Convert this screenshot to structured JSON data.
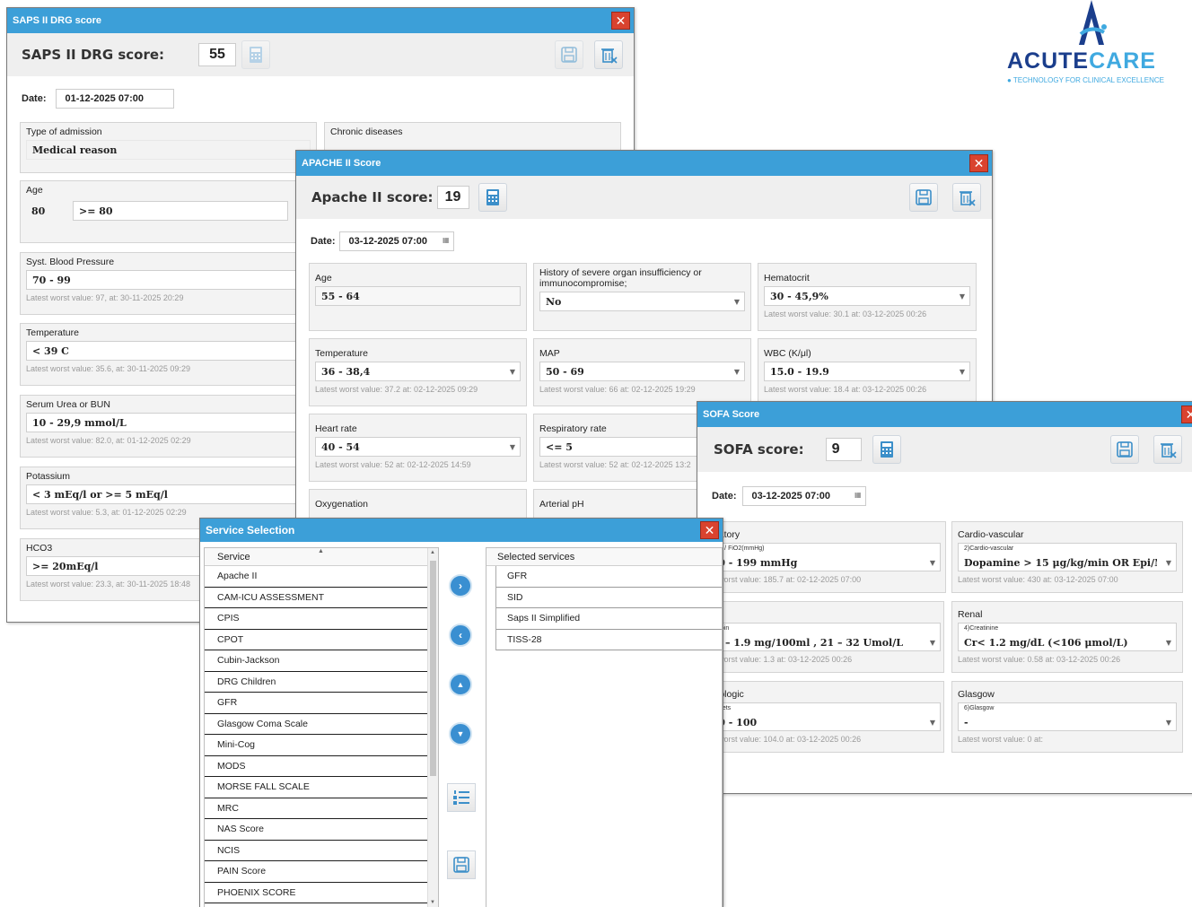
{
  "brand": {
    "name_a": "ACUTE",
    "name_b": "CARE",
    "tagline": "TECHNOLOGY FOR CLINICAL EXCELLENCE",
    "color_dark": "#1b3e8c",
    "color_light": "#3fa9e0"
  },
  "saps": {
    "title": "SAPS II DRG score",
    "score_label": "SAPS II DRG score:",
    "score": "55",
    "date_label": "Date:",
    "date": "01-12-2025 07:00",
    "type_label": "Type of admission",
    "type_value": "Medical reason",
    "chronic_label": "Chronic diseases",
    "age_label": "Age",
    "age_value": "80",
    "age_range": ">= 80",
    "bp_label": "Syst. Blood Pressure",
    "bp_value": "70 - 99",
    "bp_hint": "Latest worst value: 97, at: 30-11-2025 20:29",
    "temp_label": "Temperature",
    "temp_value": "< 39  C",
    "temp_hint": "Latest worst value: 35.6, at: 30-11-2025 09:29",
    "urea_label": "Serum Urea or BUN",
    "urea_value": "10 - 29,9 mmol/L",
    "urea_hint": "Latest worst value: 82.0, at: 01-12-2025 02:29",
    "k_label": "Potassium",
    "k_value": "< 3 mEq/l or >= 5 mEq/l",
    "k_hint": "Latest worst value: 5.3, at: 01-12-2025 02:29",
    "hco3_label": "HCO3",
    "hco3_value": ">= 20mEq/l",
    "hco3_hint": "Latest worst value: 23.3, at: 30-11-2025 18:48"
  },
  "apache": {
    "title": "APACHE II Score",
    "score_label": "Apache II score:",
    "score": "19",
    "date_label": "Date:",
    "date": "03-12-2025 07:00",
    "age_label": "Age",
    "age_value": "55 - 64",
    "hist_label": "History of severe organ insufficiency or immunocompromise;",
    "hist_value": "No",
    "hct_label": "Hematocrit",
    "hct_value": "30 - 45,9%",
    "hct_hint": "Latest worst value: 30.1 at: 03-12-2025 00:26",
    "temp_label": "Temperature",
    "temp_value": "36 - 38,4",
    "temp_hint": "Latest worst value: 37.2 at: 02-12-2025 09:29",
    "map_label": "MAP",
    "map_value": "50 - 69",
    "map_hint": "Latest worst value: 66 at: 02-12-2025 19:29",
    "wbc_label": "WBC (K/μl)",
    "wbc_value": "15.0 - 19.9",
    "wbc_hint": "Latest worst value: 18.4 at: 03-12-2025 00:26",
    "hr_label": "Heart rate",
    "hr_value": "40 - 54",
    "hr_hint": "Latest worst value: 52 at: 02-12-2025 14:59",
    "rr_label": "Respiratory rate",
    "rr_value": "<= 5",
    "rr_hint": "Latest worst value: 52 at: 02-12-2025 13:2",
    "oxy_label": "Oxygenation",
    "ph_label": "Arterial pH"
  },
  "sofa": {
    "title": "SOFA Score",
    "score_label": "SOFA score:",
    "score": "9",
    "date_label": "Date:",
    "date": "03-12-2025 07:00",
    "resp_label": "espiratory",
    "resp_sub": ")PaO2 / FiO2(mmHg)",
    "resp_value": "100 - 199 mmHg",
    "resp_hint": "atest worst value: 185.7 at: 02-12-2025 07:00",
    "cv_label": "Cardio-vascular",
    "cv_sub": "2)Cardio-vascular",
    "cv_value": "Dopamine > 15 μg/kg/min OR Epi/Noi",
    "cv_hint": "Latest worst value: 430 at: 03-12-2025 07:00",
    "hep_label": "épatic",
    "hep_sub": ")Bilirubin",
    "hep_value": "1.2 – 1.9 mg/100ml ,  21 – 32 Umol/L",
    "hep_hint": "atest worst value: 1.3 at: 03-12-2025 00:26",
    "renal_label": "Renal",
    "renal_sub": "4)Creatinine",
    "renal_value": "Cr< 1.2 mg/dL (<106 μmol/L)",
    "renal_hint": "Latest worst value: 0.58 at: 03-12-2025 00:26",
    "hem_label": "ematologic",
    "hem_sub": ")Platelets",
    "hem_value": "150 - 100",
    "hem_hint": "atest worst value: 104.0 at: 03-12-2025 00:26",
    "gcs_label": "Glasgow",
    "gcs_sub": "6)Glasgow",
    "gcs_value": "-",
    "gcs_hint": "Latest worst value: 0 at:"
  },
  "service": {
    "title": "Service Selection",
    "col_service": "Service",
    "col_selected": "Selected services",
    "services": [
      "Apache II",
      "CAM-ICU ASSESSMENT",
      "CPIS",
      "CPOT",
      "Cubin-Jackson",
      "DRG Children",
      "GFR",
      "Glasgow Coma Scale",
      "Mini-Cog",
      "MODS",
      "MORSE FALL SCALE",
      "MRC",
      "NAS Score",
      "NCIS",
      "PAIN Score",
      "PHOENIX SCORE"
    ],
    "selected": [
      "GFR",
      "SID",
      "Saps II Simplified",
      "TISS-28"
    ]
  }
}
